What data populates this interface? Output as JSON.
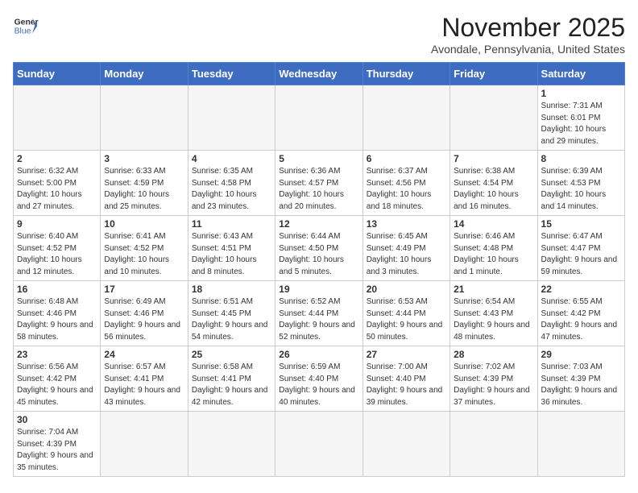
{
  "header": {
    "logo_general": "General",
    "logo_blue": "Blue",
    "month_title": "November 2025",
    "location": "Avondale, Pennsylvania, United States"
  },
  "weekdays": [
    "Sunday",
    "Monday",
    "Tuesday",
    "Wednesday",
    "Thursday",
    "Friday",
    "Saturday"
  ],
  "weeks": [
    [
      {
        "day": "",
        "info": ""
      },
      {
        "day": "",
        "info": ""
      },
      {
        "day": "",
        "info": ""
      },
      {
        "day": "",
        "info": ""
      },
      {
        "day": "",
        "info": ""
      },
      {
        "day": "",
        "info": ""
      },
      {
        "day": "1",
        "info": "Sunrise: 7:31 AM\nSunset: 6:01 PM\nDaylight: 10 hours and 29 minutes."
      }
    ],
    [
      {
        "day": "2",
        "info": "Sunrise: 6:32 AM\nSunset: 5:00 PM\nDaylight: 10 hours and 27 minutes."
      },
      {
        "day": "3",
        "info": "Sunrise: 6:33 AM\nSunset: 4:59 PM\nDaylight: 10 hours and 25 minutes."
      },
      {
        "day": "4",
        "info": "Sunrise: 6:35 AM\nSunset: 4:58 PM\nDaylight: 10 hours and 23 minutes."
      },
      {
        "day": "5",
        "info": "Sunrise: 6:36 AM\nSunset: 4:57 PM\nDaylight: 10 hours and 20 minutes."
      },
      {
        "day": "6",
        "info": "Sunrise: 6:37 AM\nSunset: 4:56 PM\nDaylight: 10 hours and 18 minutes."
      },
      {
        "day": "7",
        "info": "Sunrise: 6:38 AM\nSunset: 4:54 PM\nDaylight: 10 hours and 16 minutes."
      },
      {
        "day": "8",
        "info": "Sunrise: 6:39 AM\nSunset: 4:53 PM\nDaylight: 10 hours and 14 minutes."
      }
    ],
    [
      {
        "day": "9",
        "info": "Sunrise: 6:40 AM\nSunset: 4:52 PM\nDaylight: 10 hours and 12 minutes."
      },
      {
        "day": "10",
        "info": "Sunrise: 6:41 AM\nSunset: 4:52 PM\nDaylight: 10 hours and 10 minutes."
      },
      {
        "day": "11",
        "info": "Sunrise: 6:43 AM\nSunset: 4:51 PM\nDaylight: 10 hours and 8 minutes."
      },
      {
        "day": "12",
        "info": "Sunrise: 6:44 AM\nSunset: 4:50 PM\nDaylight: 10 hours and 5 minutes."
      },
      {
        "day": "13",
        "info": "Sunrise: 6:45 AM\nSunset: 4:49 PM\nDaylight: 10 hours and 3 minutes."
      },
      {
        "day": "14",
        "info": "Sunrise: 6:46 AM\nSunset: 4:48 PM\nDaylight: 10 hours and 1 minute."
      },
      {
        "day": "15",
        "info": "Sunrise: 6:47 AM\nSunset: 4:47 PM\nDaylight: 9 hours and 59 minutes."
      }
    ],
    [
      {
        "day": "16",
        "info": "Sunrise: 6:48 AM\nSunset: 4:46 PM\nDaylight: 9 hours and 58 minutes."
      },
      {
        "day": "17",
        "info": "Sunrise: 6:49 AM\nSunset: 4:46 PM\nDaylight: 9 hours and 56 minutes."
      },
      {
        "day": "18",
        "info": "Sunrise: 6:51 AM\nSunset: 4:45 PM\nDaylight: 9 hours and 54 minutes."
      },
      {
        "day": "19",
        "info": "Sunrise: 6:52 AM\nSunset: 4:44 PM\nDaylight: 9 hours and 52 minutes."
      },
      {
        "day": "20",
        "info": "Sunrise: 6:53 AM\nSunset: 4:44 PM\nDaylight: 9 hours and 50 minutes."
      },
      {
        "day": "21",
        "info": "Sunrise: 6:54 AM\nSunset: 4:43 PM\nDaylight: 9 hours and 48 minutes."
      },
      {
        "day": "22",
        "info": "Sunrise: 6:55 AM\nSunset: 4:42 PM\nDaylight: 9 hours and 47 minutes."
      }
    ],
    [
      {
        "day": "23",
        "info": "Sunrise: 6:56 AM\nSunset: 4:42 PM\nDaylight: 9 hours and 45 minutes."
      },
      {
        "day": "24",
        "info": "Sunrise: 6:57 AM\nSunset: 4:41 PM\nDaylight: 9 hours and 43 minutes."
      },
      {
        "day": "25",
        "info": "Sunrise: 6:58 AM\nSunset: 4:41 PM\nDaylight: 9 hours and 42 minutes."
      },
      {
        "day": "26",
        "info": "Sunrise: 6:59 AM\nSunset: 4:40 PM\nDaylight: 9 hours and 40 minutes."
      },
      {
        "day": "27",
        "info": "Sunrise: 7:00 AM\nSunset: 4:40 PM\nDaylight: 9 hours and 39 minutes."
      },
      {
        "day": "28",
        "info": "Sunrise: 7:02 AM\nSunset: 4:39 PM\nDaylight: 9 hours and 37 minutes."
      },
      {
        "day": "29",
        "info": "Sunrise: 7:03 AM\nSunset: 4:39 PM\nDaylight: 9 hours and 36 minutes."
      }
    ],
    [
      {
        "day": "30",
        "info": "Sunrise: 7:04 AM\nSunset: 4:39 PM\nDaylight: 9 hours and 35 minutes."
      },
      {
        "day": "",
        "info": ""
      },
      {
        "day": "",
        "info": ""
      },
      {
        "day": "",
        "info": ""
      },
      {
        "day": "",
        "info": ""
      },
      {
        "day": "",
        "info": ""
      },
      {
        "day": "",
        "info": ""
      }
    ]
  ]
}
